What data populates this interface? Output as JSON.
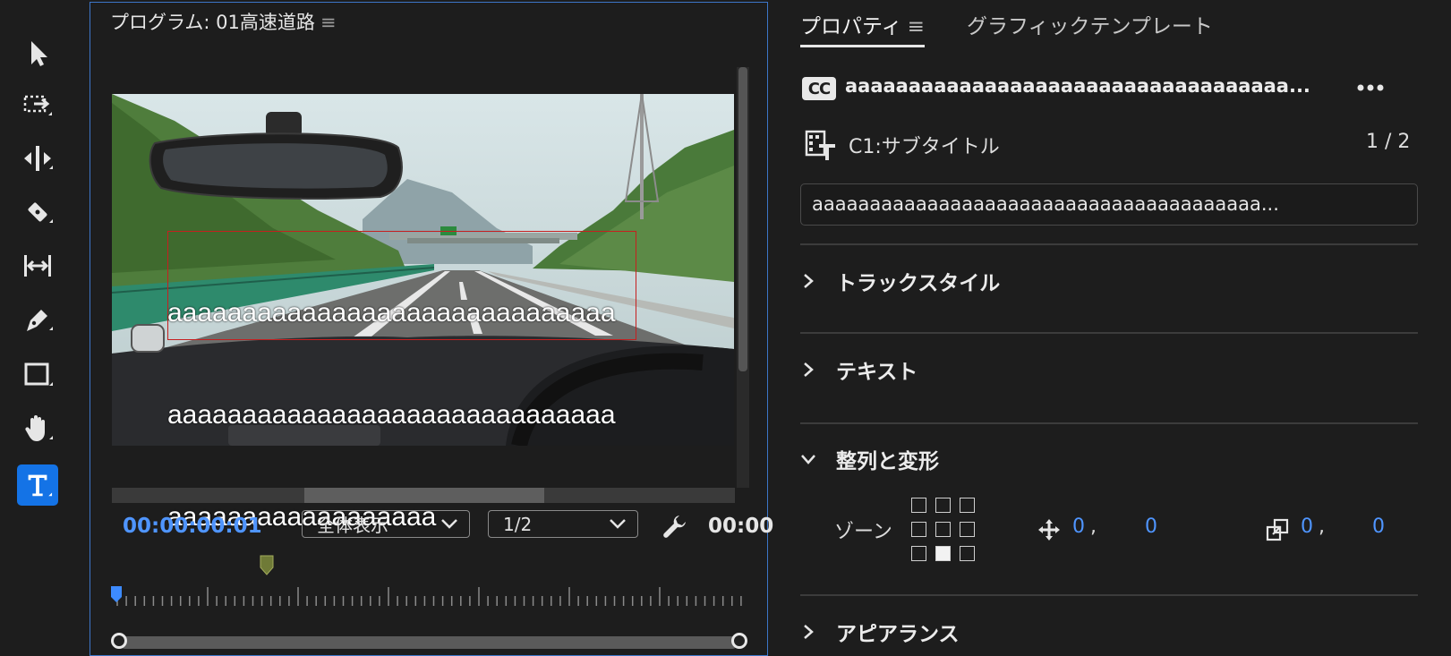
{
  "tools": [
    {
      "id": "selection",
      "icon": "selection-arrow-icon"
    },
    {
      "id": "track-select",
      "icon": "track-select-forward-icon"
    },
    {
      "id": "ripple-edit",
      "icon": "ripple-edit-icon"
    },
    {
      "id": "razor",
      "icon": "razor-icon"
    },
    {
      "id": "slip",
      "icon": "slip-icon"
    },
    {
      "id": "pen",
      "icon": "pen-icon"
    },
    {
      "id": "rectangle",
      "icon": "rectangle-icon"
    },
    {
      "id": "hand",
      "icon": "hand-icon"
    },
    {
      "id": "type",
      "icon": "type-tool-icon",
      "active": true
    }
  ],
  "program": {
    "title": "プログラム: 01高速道路",
    "menu_glyph": "≡",
    "subtitle_lines": [
      "aaaaaaaaaaaaaaaaaaaaaaaaaaaaaa",
      "aaaaaaaaaaaaaaaaaaaaaaaaaaaaaa",
      "aaaaaaaaaaaaaaaaaa"
    ],
    "timecode": "00:00:00:01",
    "fit_dropdown": "全体表示",
    "resolution_dropdown": "1/2",
    "end_timecode": "00:00"
  },
  "properties": {
    "tabs": {
      "active": "プロパティ",
      "menu_glyph": "≡",
      "other": "グラフィックテンプレート"
    },
    "cc_badge": "CC",
    "caption_name": "aaaaaaaaaaaaaaaaaaaaaaaaaaaaaaaaaaa...",
    "track_name": "C1:サブタイトル",
    "track_count": "1 / 2",
    "caption_text": "aaaaaaaaaaaaaaaaaaaaaaaaaaaaaaaaaaaaaaa...",
    "sections": {
      "track_style": "トラックスタイル",
      "text": "テキスト",
      "align_transform": "整列と変形",
      "appearance": "アピアランス"
    },
    "zone_label": "ゾーン",
    "zone_selected": {
      "row": 3,
      "col": 2
    },
    "position": {
      "x": "0",
      "y": "0"
    },
    "scale": {
      "x": "0",
      "y": "0"
    },
    "comma": ","
  },
  "colors": {
    "accent": "#4f95ff",
    "active_tool": "#1473e6",
    "subtitle_box": "#c61f1f",
    "panel_border": "#3d76c8"
  }
}
